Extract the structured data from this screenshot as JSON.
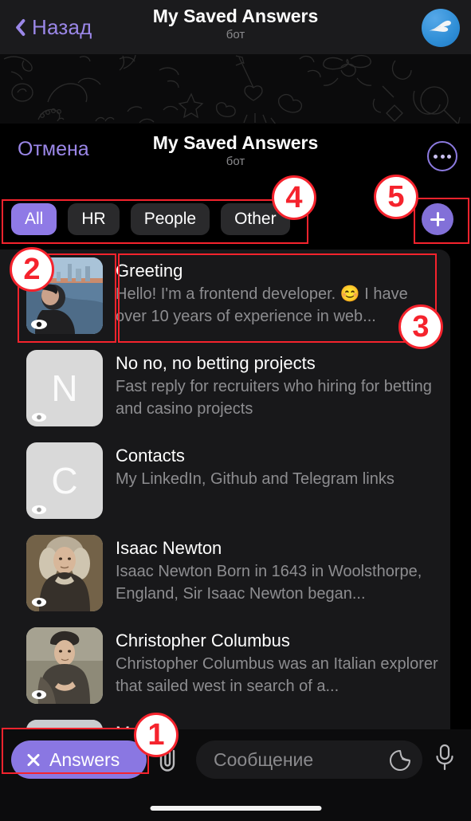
{
  "nav": {
    "back_label": "Назад",
    "title": "My Saved Answers",
    "subtitle": "бот",
    "avatar_icon": "telegram-wing-avatar"
  },
  "sheet": {
    "cancel_label": "Отмена",
    "title": "My Saved Answers",
    "subtitle": "бот",
    "more_icon": "more-circle-icon",
    "add_icon": "plus-icon"
  },
  "chips": [
    {
      "label": "All",
      "active": true
    },
    {
      "label": "HR",
      "active": false
    },
    {
      "label": "People",
      "active": false
    },
    {
      "label": "Other",
      "active": false
    }
  ],
  "answers": [
    {
      "title": "Greeting",
      "subtitle": "Hello! I'm a frontend developer. 😊  I have over 10 years of experience in web...",
      "thumb_type": "photo-portrait-waterfront",
      "badge_icon": "eye-icon"
    },
    {
      "title": "No no, no betting projects",
      "subtitle": "Fast reply for recruiters who hiring for betting and casino projects",
      "thumb_type": "letter",
      "thumb_letter": "N",
      "badge_icon": "eye-icon"
    },
    {
      "title": "Contacts",
      "subtitle": "My LinkedIn, Github and Telegram links",
      "thumb_type": "letter",
      "thumb_letter": "C",
      "badge_icon": "eye-icon"
    },
    {
      "title": "Isaac Newton",
      "subtitle": "Isaac Newton Born in 1643 in Woolsthorpe, England, Sir Isaac Newton began...",
      "thumb_type": "portrait-newton",
      "badge_icon": "eye-icon"
    },
    {
      "title": "Christopher Columbus",
      "subtitle": "Christopher Columbus was an Italian explorer that sailed west in search of a...",
      "thumb_type": "portrait-columbus",
      "badge_icon": "eye-icon"
    },
    {
      "title": "M",
      "subtitle": "",
      "thumb_type": "photo-truck",
      "badge_icon": "eye-icon"
    }
  ],
  "bottom": {
    "answers_label": "Answers",
    "answers_close_icon": "close-x-icon",
    "attach_icon": "paperclip-icon",
    "message_placeholder": "Сообщение",
    "sticker_icon": "sticker-icon",
    "mic_icon": "microphone-icon"
  },
  "annotations": [
    {
      "number": "1"
    },
    {
      "number": "2"
    },
    {
      "number": "3"
    },
    {
      "number": "4"
    },
    {
      "number": "5"
    }
  ],
  "colors": {
    "accent_purple": "#8a77e2",
    "annotation_red": "#f5232d",
    "panel": "#18181a"
  }
}
